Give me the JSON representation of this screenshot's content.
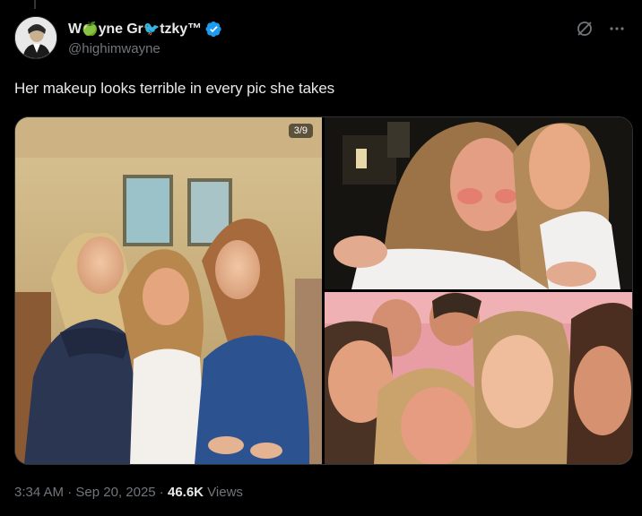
{
  "author": {
    "display_name": "W❣yne Gr❤tzky™",
    "display_name_text": "Wayne Gretzky",
    "handle": "@highimwayne",
    "verified": true
  },
  "tweet": {
    "text": "Her makeup looks terrible in every pic she takes"
  },
  "media": {
    "counter": "3/9",
    "photos": [
      {
        "name": "photo-three-girls-posing"
      },
      {
        "name": "photo-two-girls-closeup"
      },
      {
        "name": "photo-group-selfie"
      }
    ]
  },
  "meta": {
    "time": "3:34 AM",
    "separator1": " · ",
    "date": "Sep 20, 2025",
    "separator2": " · ",
    "views_count": "46.6K",
    "views_label": " Views"
  },
  "colors": {
    "background": "#000000",
    "text": "#e7e9ea",
    "secondary": "#71767b",
    "verified": "#1d9bf0",
    "border": "#2f3336"
  },
  "icons": [
    "verified-badge-icon",
    "grok-icon",
    "more-options-icon"
  ]
}
